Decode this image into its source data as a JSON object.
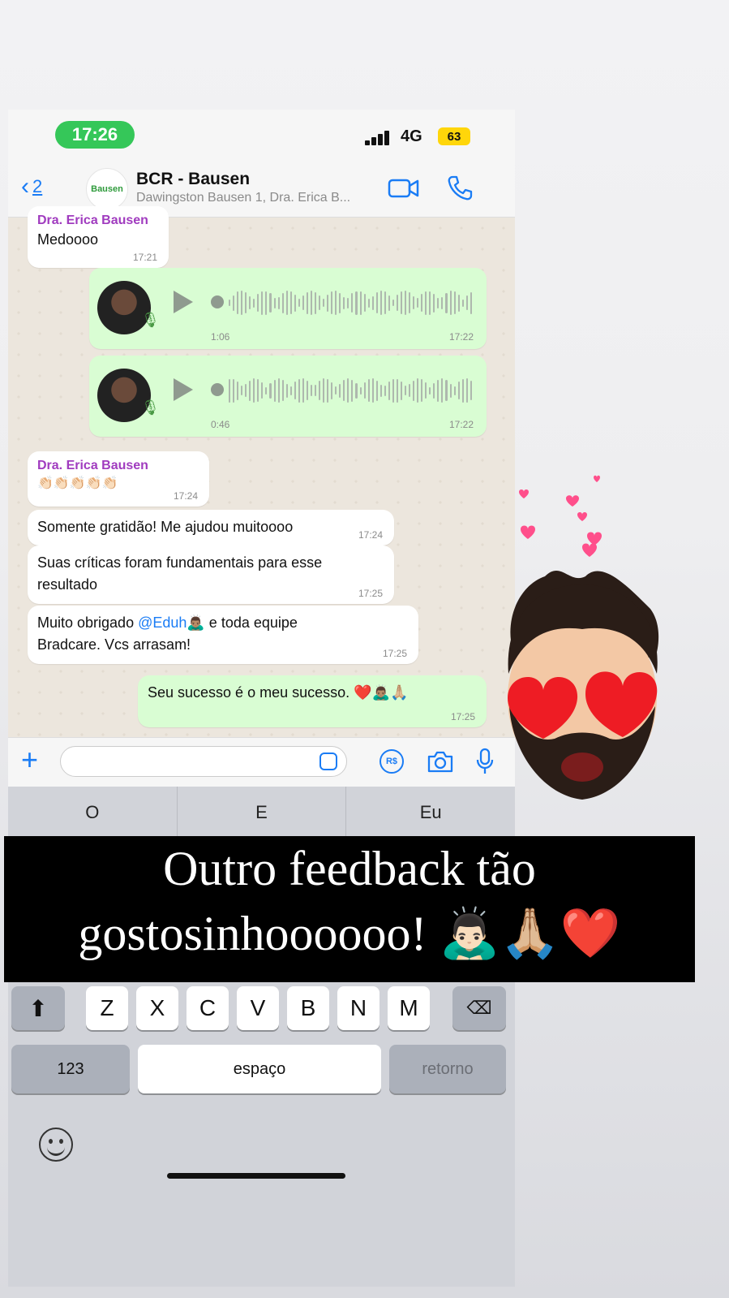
{
  "status_bar": {
    "time": "17:26",
    "network": "4G",
    "battery": "63"
  },
  "header": {
    "back_count": "2",
    "group_avatar_text": "Bausen",
    "title": "BCR - Bausen",
    "subtitle": "Dawingston Bausen 1, Dra. Erica B...",
    "icons": [
      "video-call-icon",
      "phone-call-icon"
    ]
  },
  "messages": {
    "m1": {
      "sender": "Dra. Erica Bausen",
      "text": "Medoooo",
      "time": "17:21"
    },
    "voice1": {
      "duration": "1:06",
      "time": "17:22"
    },
    "voice2": {
      "duration": "0:46",
      "time": "17:22"
    },
    "m2": {
      "sender": "Dra. Erica Bausen",
      "text": "👏🏻👏🏻👏🏻👏🏻👏🏻",
      "time": "17:24"
    },
    "m3": {
      "text": "Somente gratidão! Me ajudou muitoooo",
      "time": "17:24"
    },
    "m4": {
      "text": "Suas críticas foram fundamentais para esse resultado",
      "time": "17:25"
    },
    "m5": {
      "text_before": "Muito obrigado ",
      "mention": "@Eduh",
      "text_after": "🙇🏽‍♂️ e toda equipe Bradcare. Vcs arrasam!",
      "time": "17:25"
    },
    "m6": {
      "text": "Seu sucesso é o meu sucesso. ❤️🙇🏽‍♂️🙏🏼",
      "time": "17:25"
    }
  },
  "input": {
    "value": "",
    "placeholder": ""
  },
  "keyboard": {
    "suggestions": [
      "O",
      "E",
      "Eu"
    ],
    "letters_row": [
      "Z",
      "X",
      "C",
      "V",
      "B",
      "N",
      "M"
    ],
    "numbers_key": "123",
    "space_key": "espaço",
    "return_key": "retorno"
  },
  "caption": {
    "line1": "Outro feedback tão",
    "line2": "gostosinhoooooo! 🙇🏻‍♂️🙏🏼❤️"
  },
  "colors": {
    "accent": "#1a7cf5",
    "outgoing_bubble": "#d9fdd3",
    "sender_name": "#a03bbf",
    "time_pill": "#35c759"
  }
}
